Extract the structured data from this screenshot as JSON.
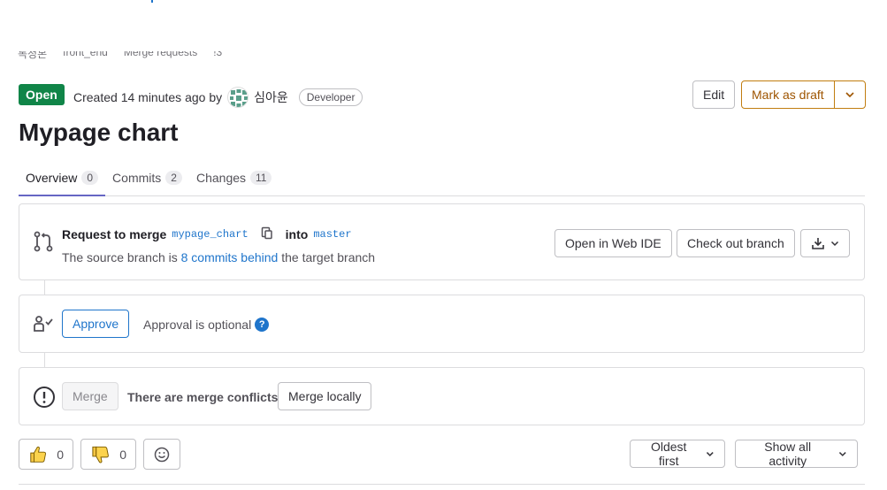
{
  "breadcrumb": [
    "독정본",
    "front_end",
    "Merge requests",
    "!3"
  ],
  "header": {
    "status": "Open",
    "created_text": "Created 14 minutes ago by",
    "author": "심아윤",
    "role": "Developer",
    "edit_label": "Edit",
    "draft_label": "Mark as draft"
  },
  "title": "Mypage chart",
  "tabs": [
    {
      "label": "Overview",
      "count": "0"
    },
    {
      "label": "Commits",
      "count": "2"
    },
    {
      "label": "Changes",
      "count": "11"
    }
  ],
  "merge_request": {
    "request_label": "Request to merge",
    "source_branch": "mypage_chart",
    "into_label": "into",
    "target_branch": "master",
    "sub_prefix": "The source branch is",
    "sub_link": "8 commits behind",
    "sub_suffix": "the target branch",
    "webide_label": "Open in Web IDE",
    "checkout_label": "Check out branch"
  },
  "approval": {
    "approve_label": "Approve",
    "status_text": "Approval is optional"
  },
  "conflicts": {
    "merge_label": "Merge",
    "message": "There are merge conflicts",
    "merge_locally_label": "Merge locally"
  },
  "reactions": {
    "thumbs_up_count": "0",
    "thumbs_down_count": "0"
  },
  "sort": {
    "order_label": "Oldest first",
    "filter_label": "Show all activity"
  },
  "colors": {
    "open_badge": "#108548",
    "link": "#1f75cb",
    "draft_border": "#c17d10",
    "tab_underline": "#6666c4"
  }
}
